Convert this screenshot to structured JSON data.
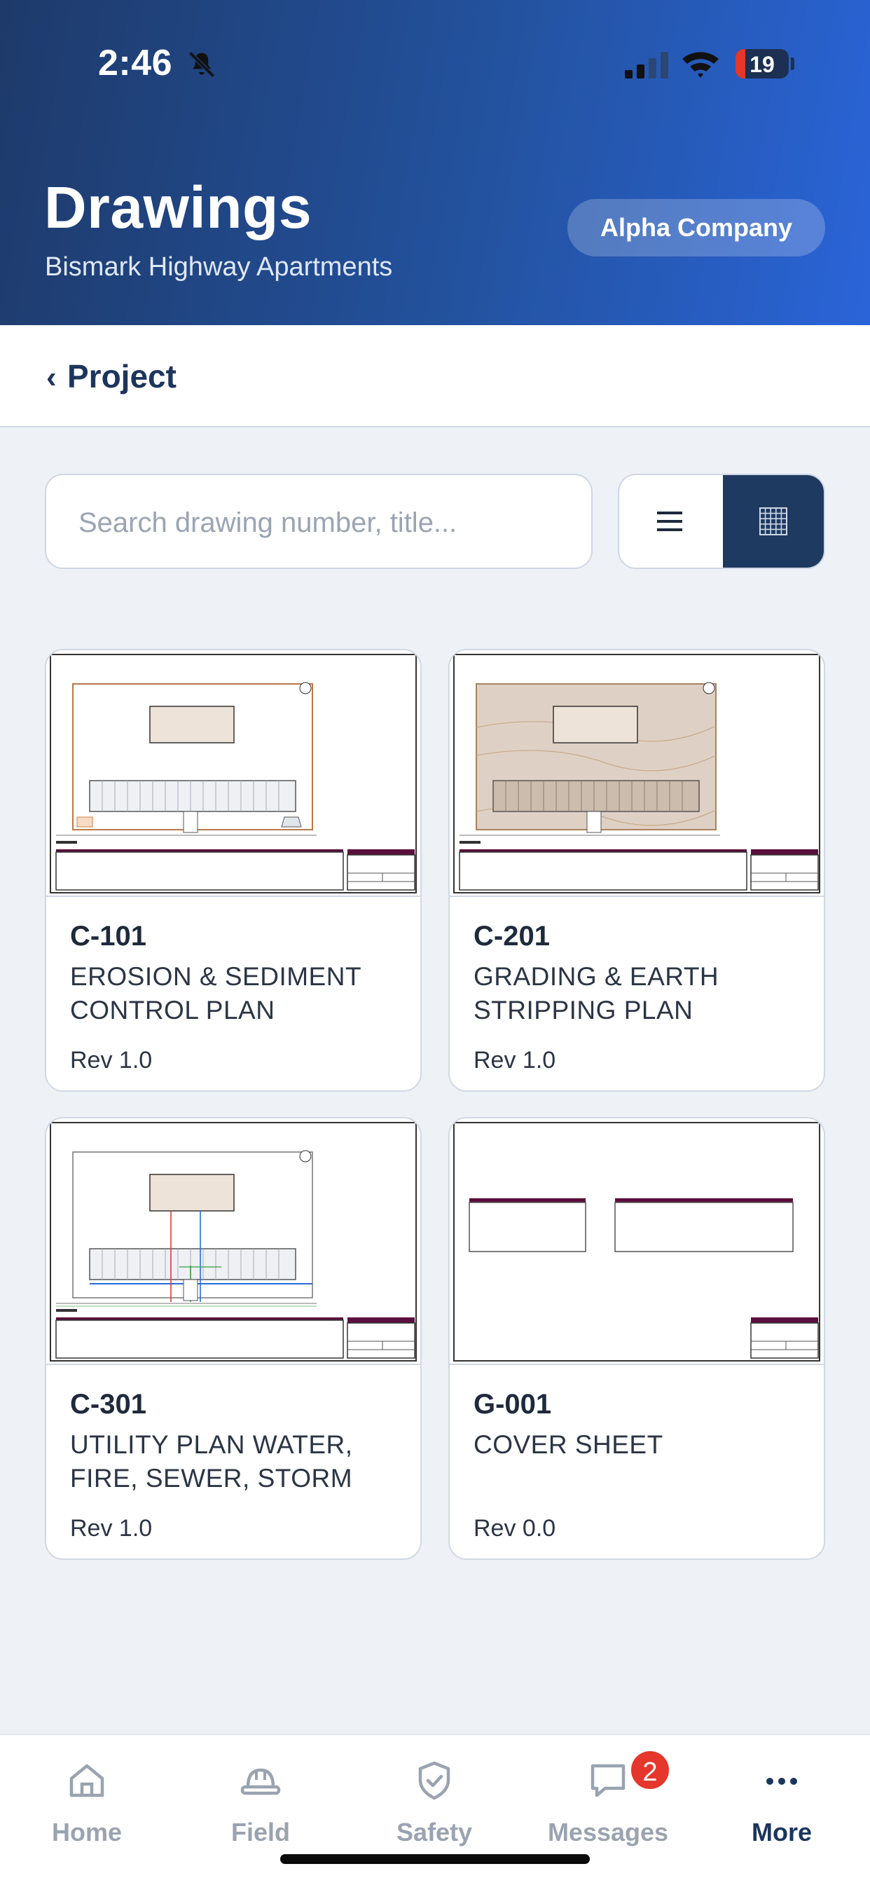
{
  "status_bar": {
    "time": "2:46",
    "battery": "19",
    "battery_level": 0.19
  },
  "header": {
    "title": "Drawings",
    "subtitle": "Bismark Highway Apartments",
    "company_button": "Alpha Company"
  },
  "nav": {
    "back_label": "Project",
    "back_chevron": "‹"
  },
  "search": {
    "placeholder": "Search drawing number, title...",
    "value": ""
  },
  "view_toggle": {
    "options": [
      "list-icon",
      "grid-icon"
    ],
    "selected": "grid"
  },
  "drawings": [
    {
      "number": "C-101",
      "title": "EROSION & SEDIMENT CONTROL PLAN",
      "rev": "Rev 1.0"
    },
    {
      "number": "C-201",
      "title": "GRADING & EARTH STRIPPING PLAN",
      "rev": "Rev 1.0"
    },
    {
      "number": "C-301",
      "title": "UTILITY PLAN WATER, FIRE, SEWER, STORM",
      "rev": "Rev 1.0"
    },
    {
      "number": "G-001",
      "title": "COVER SHEET",
      "rev": "Rev 0.0"
    }
  ],
  "tabs": [
    {
      "label": "Home",
      "icon": "home-icon"
    },
    {
      "label": "Field",
      "icon": "hardhat-icon"
    },
    {
      "label": "Safety",
      "icon": "shield-check-icon"
    },
    {
      "label": "Messages",
      "icon": "message-icon",
      "badge": "2"
    },
    {
      "label": "More",
      "icon": "more-icon"
    }
  ],
  "colors": {
    "accent": "#1e3a60",
    "badge": "#e5372b",
    "titleblock": "#5a0f3c"
  }
}
